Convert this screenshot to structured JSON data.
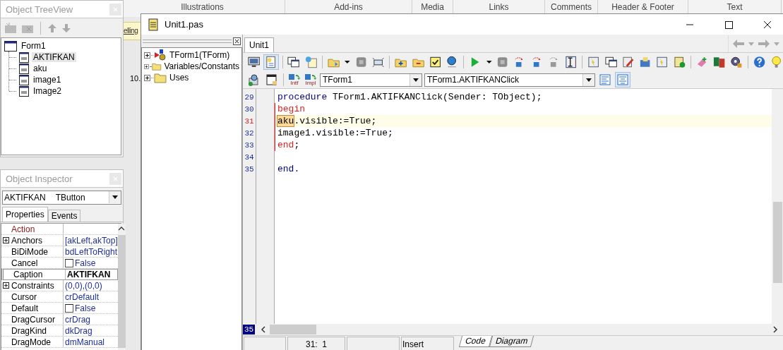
{
  "background": {
    "ribbon_groups": [
      {
        "label": "Illustrations"
      },
      {
        "label": "Add-ins"
      },
      {
        "label": "Media"
      },
      {
        "label": "Links"
      },
      {
        "label": "Comments"
      },
      {
        "label": "Header & Footer"
      },
      {
        "label": "Text"
      }
    ],
    "tooltip": "elling",
    "page_text": "10."
  },
  "tree_view": {
    "title": "Object TreeView",
    "nodes": [
      {
        "label": "Form1",
        "selected": false,
        "children": [
          {
            "label": "AKTIFKAN",
            "selected": true
          },
          {
            "label": "aku",
            "selected": false
          },
          {
            "label": "image1",
            "selected": false
          },
          {
            "label": "Image2",
            "selected": false
          }
        ]
      }
    ]
  },
  "inspector": {
    "title": "Object Inspector",
    "component": {
      "name": "AKTIFKAN",
      "type": "TButton"
    },
    "tabs": [
      {
        "label": "Properties",
        "selected": true
      },
      {
        "label": "Events",
        "selected": false
      }
    ],
    "rows": [
      {
        "name": "Action",
        "kind": "link",
        "selected": false
      },
      {
        "name": "Anchors",
        "value": "[akLeft,akTop]",
        "kind": "set",
        "selected": false
      },
      {
        "name": "BiDiMode",
        "value": "bdLeftToRight",
        "kind": "text",
        "selected": false
      },
      {
        "name": "Cancel",
        "value": "False",
        "kind": "check",
        "checked": false,
        "selected": false
      },
      {
        "name": "Caption",
        "value": "AKTIFKAN",
        "kind": "text",
        "selected": true
      },
      {
        "name": "Constraints",
        "value": "(0,0),(0,0)",
        "kind": "set",
        "selected": false
      },
      {
        "name": "Cursor",
        "value": "crDefault",
        "kind": "text",
        "selected": false
      },
      {
        "name": "Default",
        "value": "False",
        "kind": "check",
        "checked": false,
        "selected": false
      },
      {
        "name": "DragCursor",
        "value": "crDrag",
        "kind": "text",
        "selected": false
      },
      {
        "name": "DragKind",
        "value": "dkDrag",
        "kind": "text",
        "selected": false
      },
      {
        "name": "DragMode",
        "value": "dmManual",
        "kind": "text",
        "selected": false
      }
    ]
  },
  "editor": {
    "title": "Unit1.pas",
    "explorer": [
      {
        "label": "TForm1(TForm)",
        "kind": "class",
        "expanded": false
      },
      {
        "label": "Variables/Constants",
        "kind": "folder",
        "expanded": false
      },
      {
        "label": "Uses",
        "kind": "folder",
        "expanded": false
      }
    ],
    "tabs": [
      {
        "label": "Unit1",
        "selected": true
      }
    ],
    "jump_buttons": [
      {
        "label": "Intf"
      },
      {
        "label": "Impl"
      }
    ],
    "class_combo": "TForm1",
    "method_combo": "TForm1.AKTIFKANClick",
    "lines": [
      {
        "number": "29",
        "current": false,
        "in_block": false,
        "tokens": [
          {
            "text": "procedure",
            "kind": "keyword"
          },
          {
            "text": " TForm1.AKTIFKANClick(Sender: TObject);",
            "kind": "plain"
          }
        ]
      },
      {
        "number": "30",
        "current": false,
        "in_block": true,
        "tokens": [
          {
            "text": "begin",
            "kind": "match"
          }
        ]
      },
      {
        "number": "31",
        "current": true,
        "in_block": true,
        "tokens": [
          {
            "text": "aku",
            "kind": "highlight"
          },
          {
            "text": ".visible:=True;",
            "kind": "plain"
          }
        ]
      },
      {
        "number": "32",
        "current": false,
        "in_block": true,
        "tokens": [
          {
            "text": "image1.visible:=True;",
            "kind": "plain"
          }
        ]
      },
      {
        "number": "33",
        "current": false,
        "in_block": true,
        "tokens": [
          {
            "text": "end",
            "kind": "match"
          },
          {
            "text": ";",
            "kind": "plain"
          }
        ]
      },
      {
        "number": "34",
        "current": false,
        "in_block": false
      },
      {
        "number": "35",
        "current": false,
        "in_block": false,
        "tokens": [
          {
            "text": "end.",
            "kind": "keyword"
          }
        ]
      }
    ],
    "line_count_marker": "35",
    "status_bar": {
      "position": "31:  1",
      "mode": "Insert"
    },
    "view_tabs": [
      {
        "label": "Code",
        "selected": true
      },
      {
        "label": "Diagram",
        "selected": false
      }
    ]
  }
}
